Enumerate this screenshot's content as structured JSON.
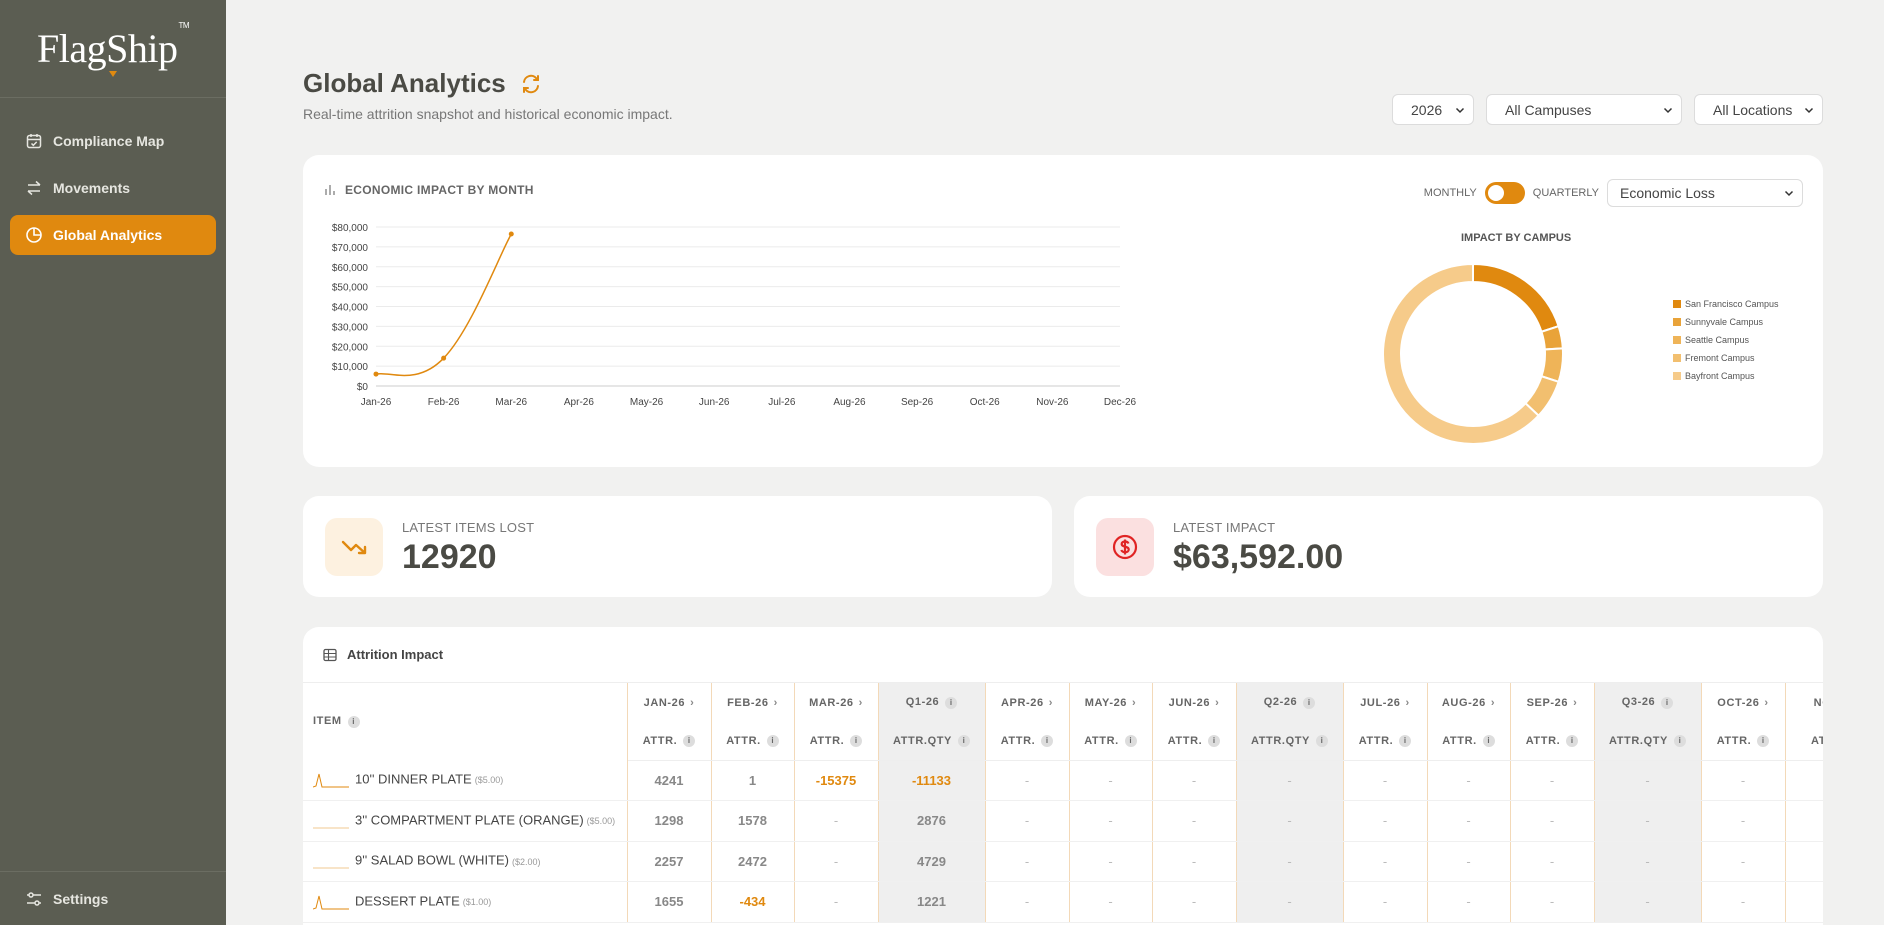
{
  "brand": {
    "name": "FlagShip",
    "tm": "TM"
  },
  "sidebar": {
    "items": [
      {
        "label": "Compliance Map",
        "icon": "calendar-check-icon",
        "active": false
      },
      {
        "label": "Movements",
        "icon": "arrows-swap-icon",
        "active": false
      },
      {
        "label": "Global Analytics",
        "icon": "pie-chart-icon",
        "active": true
      }
    ],
    "settings_label": "Settings"
  },
  "header": {
    "title": "Global Analytics",
    "subtitle": "Real-time attrition snapshot and historical economic impact.",
    "year": "2026",
    "campus": "All Campuses",
    "location": "All Locations"
  },
  "chart_panel": {
    "title": "ECONOMIC IMPACT BY MONTH",
    "toggle_left": "MONTHLY",
    "toggle_right": "QUARTERLY",
    "metric": "Economic Loss",
    "donut_title": "IMPACT BY CAMPUS"
  },
  "chart_data": [
    {
      "type": "line",
      "x": [
        "Jan-26",
        "Feb-26",
        "Mar-26",
        "Apr-26",
        "May-26",
        "Jun-26",
        "Jul-26",
        "Aug-26",
        "Sep-26",
        "Oct-26",
        "Nov-26",
        "Dec-26"
      ],
      "values": [
        6000,
        14000,
        76500,
        null,
        null,
        null,
        null,
        null,
        null,
        null,
        null,
        null
      ],
      "yticks": [
        "$0",
        "$10,000",
        "$20,000",
        "$30,000",
        "$40,000",
        "$50,000",
        "$60,000",
        "$70,000",
        "$80,000"
      ],
      "ylim": [
        0,
        80000
      ],
      "grid": true,
      "color": "#e0890f"
    },
    {
      "type": "pie",
      "title": "IMPACT BY CAMPUS",
      "legend": "right",
      "categories": [
        "San Francisco Campus",
        "Sunnyvale Campus",
        "Seattle Campus",
        "Fremont Campus",
        "Bayfront Campus"
      ],
      "values": [
        20,
        4,
        6,
        7,
        63
      ],
      "colors": [
        "#e0890f",
        "#e9a339",
        "#efb458",
        "#f2bf6f",
        "#f6cb8a"
      ]
    }
  ],
  "stats": {
    "items_lost_label": "LATEST ITEMS LOST",
    "items_lost_value": "12920",
    "impact_label": "LATEST IMPACT",
    "impact_value": "$63,592.00"
  },
  "table": {
    "title": "Attrition Impact",
    "item_header": "ITEM",
    "columns": [
      {
        "label": "JAN-26",
        "sub": "ATTR.",
        "quarter": false
      },
      {
        "label": "FEB-26",
        "sub": "ATTR.",
        "quarter": false
      },
      {
        "label": "MAR-26",
        "sub": "ATTR.",
        "quarter": false
      },
      {
        "label": "Q1-26",
        "sub": "ATTR.QTY",
        "quarter": true
      },
      {
        "label": "APR-26",
        "sub": "ATTR.",
        "quarter": false
      },
      {
        "label": "MAY-26",
        "sub": "ATTR.",
        "quarter": false
      },
      {
        "label": "JUN-26",
        "sub": "ATTR.",
        "quarter": false
      },
      {
        "label": "Q2-26",
        "sub": "ATTR.QTY",
        "quarter": true
      },
      {
        "label": "JUL-26",
        "sub": "ATTR.",
        "quarter": false
      },
      {
        "label": "AUG-26",
        "sub": "ATTR.",
        "quarter": false
      },
      {
        "label": "SEP-26",
        "sub": "ATTR.",
        "quarter": false
      },
      {
        "label": "Q3-26",
        "sub": "ATTR.QTY",
        "quarter": true
      },
      {
        "label": "OCT-26",
        "sub": "ATTR.",
        "quarter": false
      },
      {
        "label": "NOV",
        "sub": "ATTR",
        "quarter": false
      }
    ],
    "rows": [
      {
        "name": "10'' DINNER PLATE",
        "price": "($5.00)",
        "spark": "spike",
        "values": [
          "4241",
          "1",
          "-15375",
          "-11133",
          "-",
          "-",
          "-",
          "-",
          "-",
          "-",
          "-",
          "-",
          "-",
          ""
        ]
      },
      {
        "name": "3'' COMPARTMENT PLATE (ORANGE)",
        "price": "($5.00)",
        "spark": "flat",
        "values": [
          "1298",
          "1578",
          "-",
          "2876",
          "-",
          "-",
          "-",
          "-",
          "-",
          "-",
          "-",
          "-",
          "-",
          ""
        ]
      },
      {
        "name": "9'' SALAD BOWL (WHITE)",
        "price": "($2.00)",
        "spark": "flat",
        "values": [
          "2257",
          "2472",
          "-",
          "4729",
          "-",
          "-",
          "-",
          "-",
          "-",
          "-",
          "-",
          "-",
          "-",
          ""
        ]
      },
      {
        "name": "DESSERT PLATE",
        "price": "($1.00)",
        "spark": "spike",
        "values": [
          "1655",
          "-434",
          "-",
          "1221",
          "-",
          "-",
          "-",
          "-",
          "-",
          "-",
          "-",
          "-",
          "-",
          ""
        ]
      }
    ]
  }
}
